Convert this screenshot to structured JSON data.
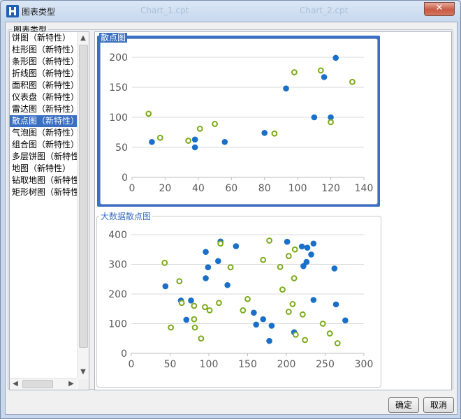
{
  "window": {
    "title": "图表类型",
    "ghost_tabs": [
      "Chart_1.cpt",
      "Chart_2.cpt"
    ],
    "close_label": "✕"
  },
  "group_label": "图表类型",
  "chart_types": [
    "饼图（新特性）",
    "柱形图（新特性）",
    "条形图（新特性）",
    "折线图（新特性）",
    "面积图（新特性）",
    "仪表盘（新特性）",
    "雷达图（新特性）",
    "散点图（新特性）",
    "气泡图（新特性）",
    "组合图（新特性）",
    "多层饼图（新特性",
    "地图（新特性）",
    "钻取地图（新特性）",
    "矩形树图（新特性）"
  ],
  "selected_index": 7,
  "preview_cards": [
    {
      "label": "散点图",
      "selected": true
    },
    {
      "label": "大数据散点图",
      "selected": false
    }
  ],
  "colors": {
    "series_blue": "#1a6fc9",
    "series_green": "#7cab1c",
    "selection": "#3a6fc2",
    "axis_text": "#5a5a5a"
  },
  "chart_data": [
    {
      "type": "scatter",
      "title": "散点图",
      "xlim": [
        0,
        140
      ],
      "ylim": [
        0,
        200
      ],
      "x_ticks": [
        "0",
        "20",
        "40",
        "60",
        "80",
        "100",
        "120",
        "140"
      ],
      "y_ticks": [
        "0",
        "50",
        "100",
        "150",
        "200"
      ],
      "grid": true,
      "series": [
        {
          "style": "filled",
          "color": "#1a6fc9",
          "points": [
            [
              12,
              59
            ],
            [
              38,
              63
            ],
            [
              38,
              50
            ],
            [
              56,
              59
            ],
            [
              80,
              74
            ],
            [
              93,
              148
            ],
            [
              110,
              100
            ],
            [
              116,
              167
            ],
            [
              120,
              100
            ],
            [
              123,
              199
            ]
          ]
        },
        {
          "style": "hollow",
          "color": "#7cab1c",
          "points": [
            [
              10,
              106
            ],
            [
              17,
              66
            ],
            [
              34,
              61
            ],
            [
              41,
              81
            ],
            [
              50,
              89
            ],
            [
              86,
              73
            ],
            [
              98,
              175
            ],
            [
              114,
              178
            ],
            [
              120,
              92
            ],
            [
              133,
              159
            ]
          ]
        }
      ]
    },
    {
      "type": "scatter",
      "title": "大数据散点图",
      "xlim": [
        0,
        300
      ],
      "ylim": [
        0,
        400
      ],
      "x_ticks": [
        "0",
        "50",
        "100",
        "150",
        "200",
        "250",
        "300"
      ],
      "y_ticks": [
        "0",
        "100",
        "200",
        "300",
        "400"
      ],
      "grid": true,
      "series": [
        {
          "style": "filled",
          "color": "#1a6fc9",
          "points": [
            [
              44,
              226
            ],
            [
              64,
              178
            ],
            [
              71,
              113
            ],
            [
              77,
              178
            ],
            [
              96,
              342
            ],
            [
              96,
              253
            ],
            [
              99,
              290
            ],
            [
              112,
              311
            ],
            [
              115,
              377
            ],
            [
              124,
              230
            ],
            [
              135,
              361
            ],
            [
              158,
              137
            ],
            [
              161,
              97
            ],
            [
              170,
              115
            ],
            [
              178,
              42
            ],
            [
              181,
              93
            ],
            [
              201,
              376
            ],
            [
              210,
              71
            ],
            [
              220,
              360
            ],
            [
              222,
              294
            ],
            [
              226,
              308
            ],
            [
              227,
              356
            ],
            [
              232,
              333
            ],
            [
              235,
              370
            ],
            [
              235,
              180
            ],
            [
              262,
              286
            ],
            [
              264,
              165
            ],
            [
              276,
              111
            ]
          ]
        },
        {
          "style": "hollow",
          "color": "#7cab1c",
          "points": [
            [
              43,
              305
            ],
            [
              51,
              87
            ],
            [
              62,
              243
            ],
            [
              65,
              170
            ],
            [
              81,
              160
            ],
            [
              81,
              115
            ],
            [
              82,
              87
            ],
            [
              90,
              50
            ],
            [
              95,
              156
            ],
            [
              101,
              145
            ],
            [
              113,
              170
            ],
            [
              115,
              370
            ],
            [
              128,
              290
            ],
            [
              144,
              145
            ],
            [
              150,
              183
            ],
            [
              170,
              315
            ],
            [
              178,
              380
            ],
            [
              192,
              291
            ],
            [
              195,
              215
            ],
            [
              203,
              140
            ],
            [
              203,
              328
            ],
            [
              208,
              166
            ],
            [
              210,
              253
            ],
            [
              211,
              350
            ],
            [
              212,
              63
            ],
            [
              221,
              131
            ],
            [
              224,
              45
            ],
            [
              247,
              100
            ],
            [
              256,
              67
            ],
            [
              266,
              34
            ]
          ]
        }
      ]
    }
  ],
  "buttons": {
    "ok": "确定",
    "cancel": "取消"
  }
}
